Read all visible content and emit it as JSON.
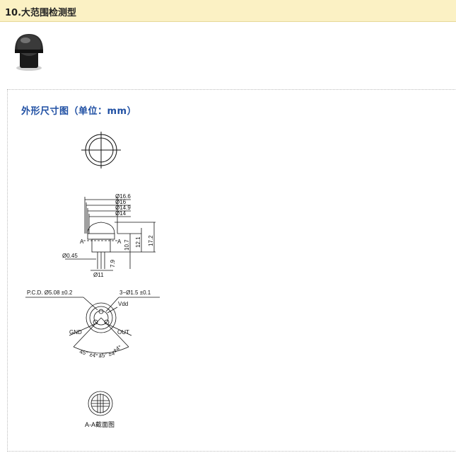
{
  "header": {
    "title": "10.大范围检测型"
  },
  "section": {
    "title": "外形尺寸图（单位：mm）"
  },
  "side_view": {
    "dims": [
      "Ø16.6",
      "Ø16",
      "Ø14.9",
      "Ø14"
    ],
    "heights": [
      "10.7",
      "12.1",
      "17.2"
    ],
    "pin": "Ø0.45",
    "pin_len": "7.9",
    "body_dia": "Ø11",
    "section_mark": "A"
  },
  "pin_view": {
    "pcd": "P.C.D. Ø5.08 ±0.2",
    "holes": "3−Ø1.5 ±0.1",
    "vdd": "Vdd",
    "gnd": "GND",
    "out": "OUT",
    "angle": "45° ±4°",
    "angle_r": "±4°"
  },
  "cross_section": {
    "caption": "A-A截面图"
  },
  "colors": {
    "header_bg": "#fbf1c4",
    "accent": "#1f4fa3"
  }
}
